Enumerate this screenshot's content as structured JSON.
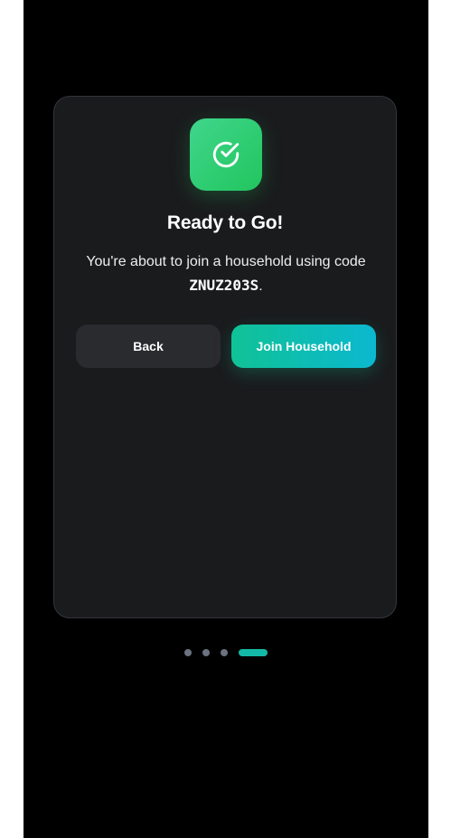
{
  "step": {
    "title": "Ready to Go!",
    "description_before": "You're about to join a household using code ",
    "code": "ZNUZ203S",
    "description_after": ".",
    "icon": "check-circle-icon"
  },
  "buttons": {
    "back_label": "Back",
    "join_label": "Join Household"
  },
  "pagination": {
    "total_steps": 4,
    "current_step": 4
  },
  "colors": {
    "icon_gradient": [
      "#3fd68c",
      "#22c55e"
    ],
    "primary_gradient": [
      "#10c296",
      "#0bb8d0"
    ],
    "active_dot": "#14b8a6",
    "inactive_dot": "#6b7280"
  }
}
